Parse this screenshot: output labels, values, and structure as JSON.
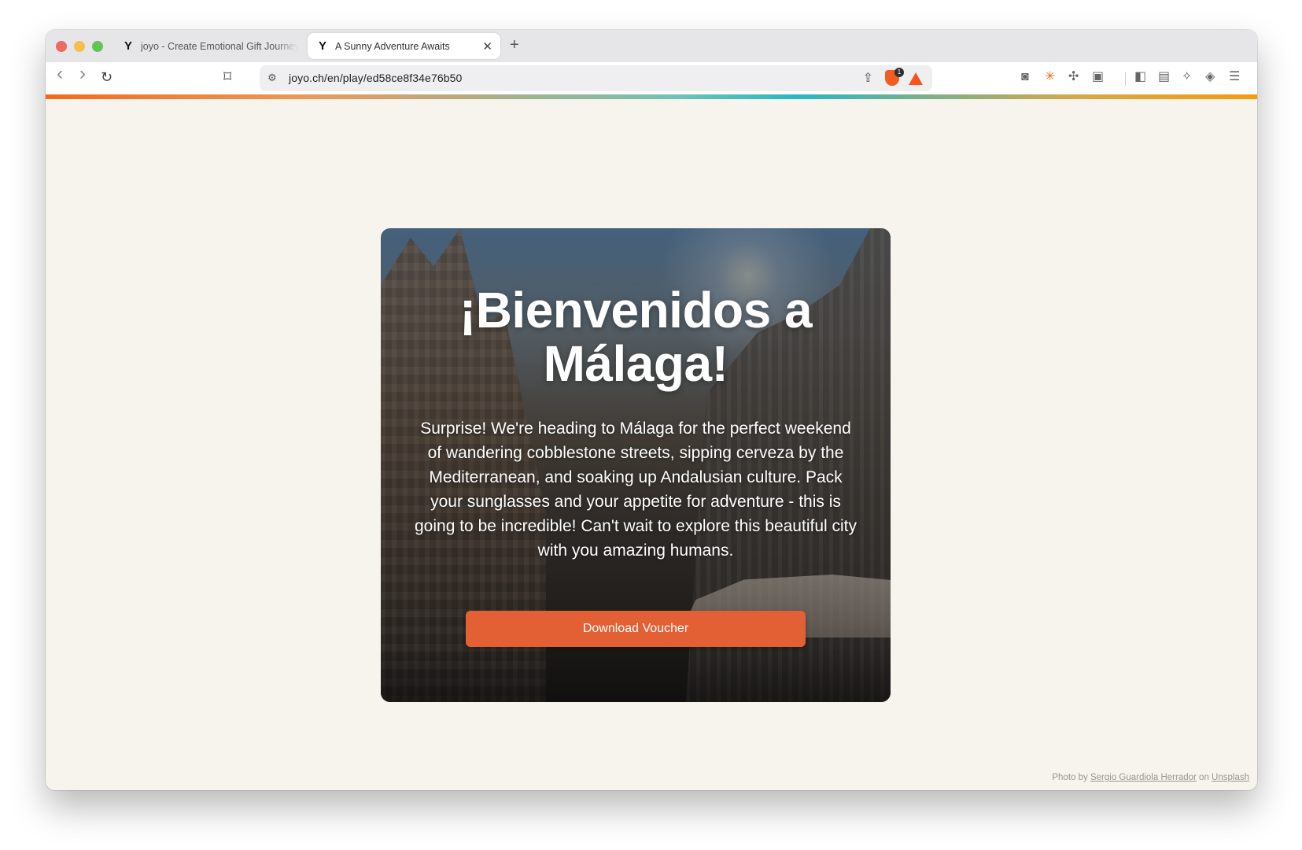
{
  "browser": {
    "tabs": [
      {
        "title": "joyo - Create Emotional Gift Journeys",
        "favicon": "Y",
        "active": false
      },
      {
        "title": "A Sunny Adventure Awaits",
        "favicon": "Y",
        "active": true
      }
    ],
    "close_glyph": "✕",
    "new_tab_glyph": "+",
    "url": "joyo.ch/en/play/ed58ce8f34e76b50",
    "shield_badge": "1",
    "icons": {
      "back": "‹",
      "forward": "›",
      "reload": "↻",
      "bookmark": "⌑",
      "tune": "⚙",
      "share": "⇪",
      "camera": "◙",
      "asterisk": "✳",
      "puzzle": "✣",
      "reader": "▣",
      "sidebar": "◧",
      "wallet": "▤",
      "leo": "✧",
      "vpn": "◈",
      "menu": "☰"
    }
  },
  "page": {
    "headline": "¡Bienvenidos a Málaga!",
    "message": "Surprise! We're heading to Málaga for the perfect weekend of wandering cobblestone streets, sipping cerveza by the Mediterranean, and soaking up Andalusian culture. Pack your sunglasses and your appetite for adventure - this is going to be incredible! Can't wait to explore this beautiful city with you amazing humans.",
    "cta_label": "Download Voucher",
    "credit": {
      "prefix": "Photo by",
      "author": "Sergio Guardiola Herrador",
      "middle": "on",
      "source": "Unsplash"
    }
  },
  "colors": {
    "accent": "#e35f34",
    "page_bg": "#f7f4ee"
  }
}
